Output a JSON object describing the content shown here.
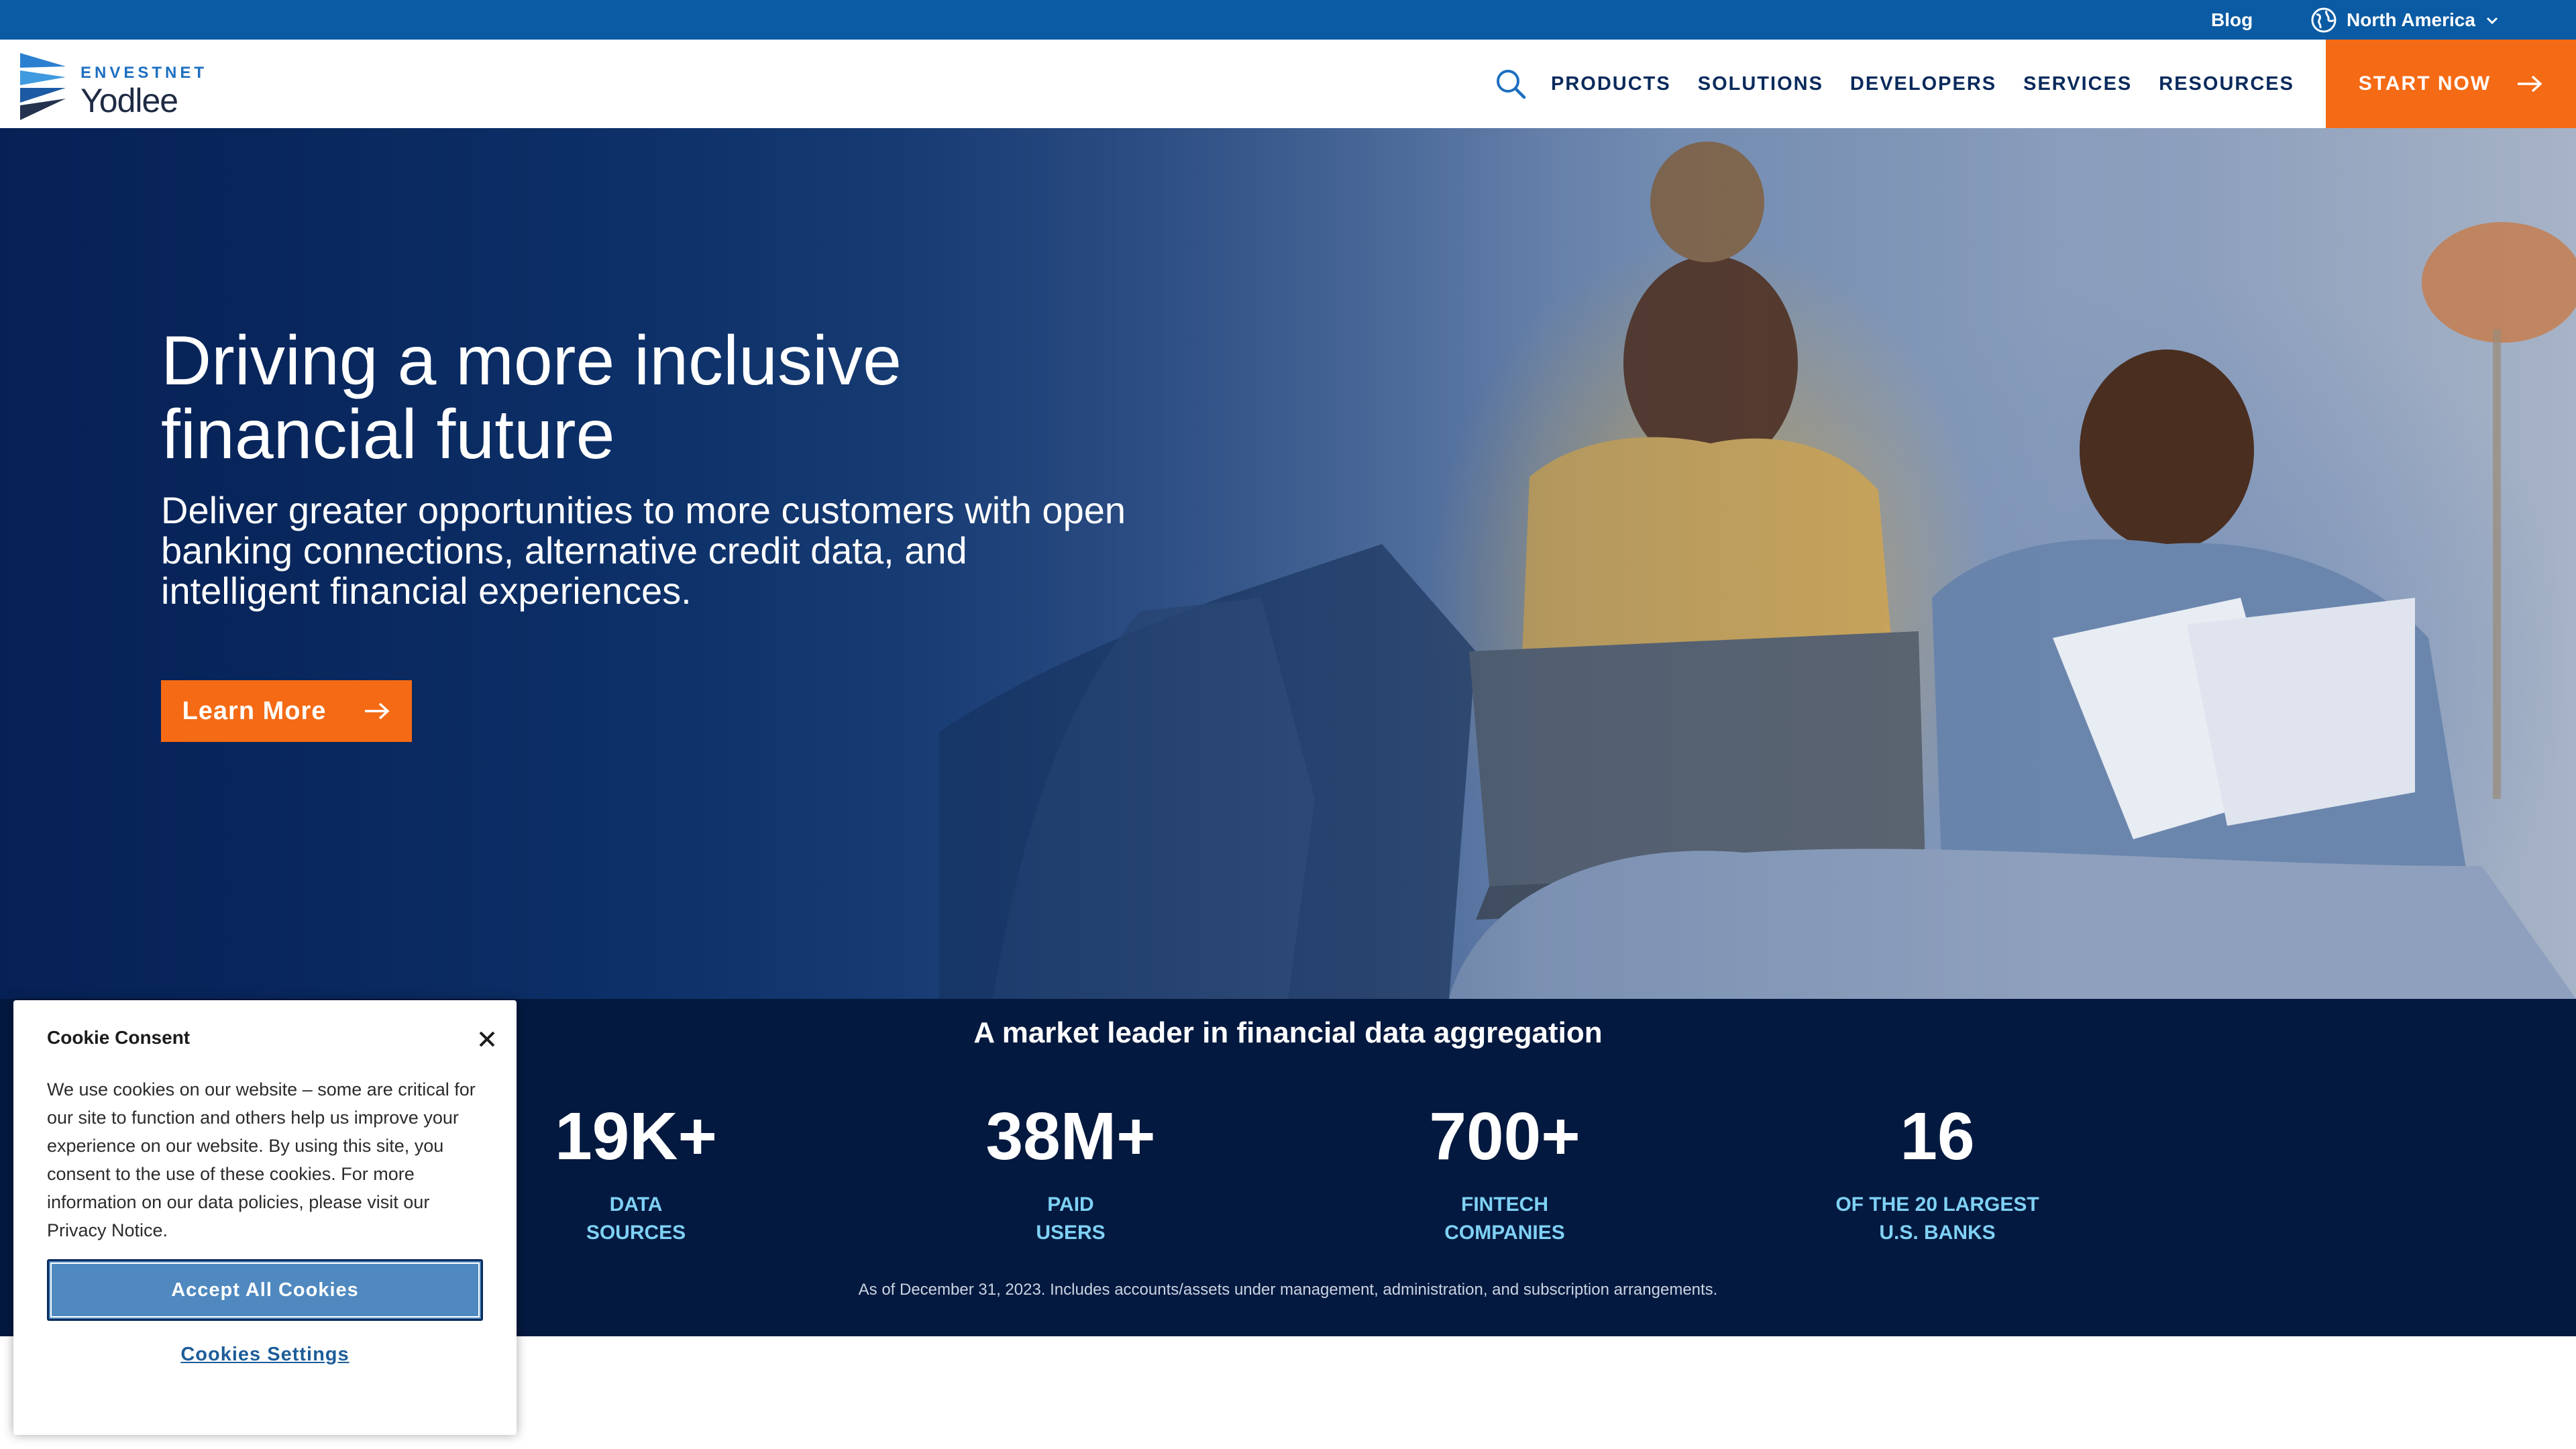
{
  "utility_bar": {
    "blog_label": "Blog",
    "region_label": "North America",
    "region_icon": "globe-icon",
    "chevron_icon": "chevron-down-icon"
  },
  "header": {
    "logo_top": "ENVESTNET",
    "logo_main": "Yodlee",
    "search_icon": "search-icon",
    "nav": [
      "PRODUCTS",
      "SOLUTIONS",
      "DEVELOPERS",
      "SERVICES",
      "RESOURCES"
    ],
    "cta_label": "START NOW"
  },
  "hero": {
    "title": "Driving a more inclusive financial future",
    "subtitle": "Deliver greater opportunities to more customers with open banking connections, alternative credit data, and intelligent financial experiences.",
    "button_label": "Learn More"
  },
  "stats": {
    "title": "A market leader in financial data aggregation",
    "items": [
      {
        "value": "19K+",
        "label_line1": "DATA",
        "label_line2": "SOURCES"
      },
      {
        "value": "38M+",
        "label_line1": "PAID",
        "label_line2": "USERS"
      },
      {
        "value": "700+",
        "label_line1": "FINTECH",
        "label_line2": "COMPANIES"
      },
      {
        "value": "16",
        "label_line1": "OF THE 20 LARGEST",
        "label_line2": "U.S. BANKS"
      }
    ],
    "footnote": "As of December 31, 2023. Includes accounts/assets under management, administration, and subscription arrangements."
  },
  "cookie": {
    "title": "Cookie Consent",
    "body": "We use cookies on our website – some are critical for our site to function and others help us improve your experience on our website. By using this site, you consent to the use of these cookies. For more information on our data policies, please visit our Privacy Notice.",
    "accept_label": "Accept All Cookies",
    "settings_label": "Cookies Settings"
  },
  "colors": {
    "utility_bar": "#0a5ba3",
    "accent_orange": "#f56a14",
    "navy": "#0a2a5c",
    "stats_bg": "#04193f",
    "stat_label": "#7fd1f4"
  }
}
